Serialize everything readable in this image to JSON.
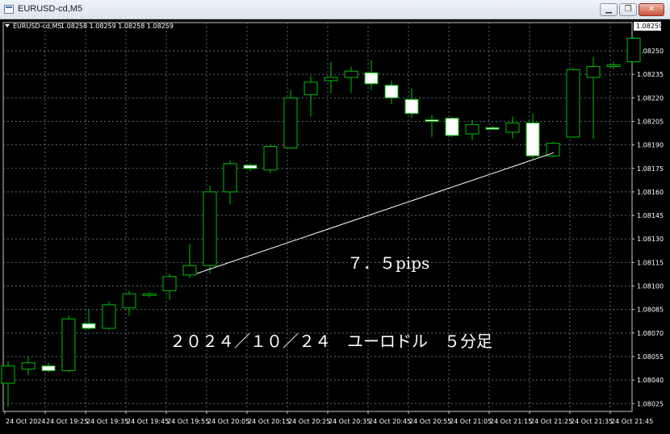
{
  "window": {
    "title": "EURUSD-cd,M5",
    "minimize_icon": "minimize-icon",
    "maximize_icon": "restore-icon",
    "close_icon": "close-icon"
  },
  "chart_info": {
    "symbol": "EURUSD-cd,M5",
    "ohlc": "1.08258 1.08259 1.08258 1.08259"
  },
  "colors": {
    "background": "#000000",
    "grid": "#5a6a7a",
    "bull": "#00c000",
    "bear_fill": "#ffffff",
    "text": "#ffffff"
  },
  "annotations": {
    "pips": "７．５pips",
    "caption": "２０２４／１０／２４　ユーロドル　５分足"
  },
  "chart_data": {
    "type": "candlestick",
    "title": "EURUSD-cd,M5",
    "ylim": [
      1.0802,
      1.08268
    ],
    "y_ticks": [
      "1.08250",
      "1.08235",
      "1.08220",
      "1.08205",
      "1.08190",
      "1.08175",
      "1.08160",
      "1.08145",
      "1.08130",
      "1.08115",
      "1.08100",
      "1.08085",
      "1.08070",
      "1.08055",
      "1.08040",
      "1.08025"
    ],
    "current_price": "1.08259",
    "x_labels": [
      "24 Oct 2024",
      "24 Oct 19:25",
      "24 Oct 19:35",
      "24 Oct 19:45",
      "24 Oct 19:55",
      "24 Oct 20:05",
      "24 Oct 20:15",
      "24 Oct 20:25",
      "24 Oct 20:35",
      "24 Oct 20:45",
      "24 Oct 20:55",
      "24 Oct 21:05",
      "24 Oct 21:15",
      "24 Oct 21:25",
      "24 Oct 21:35",
      "24 Oct 21:45"
    ],
    "candles": [
      {
        "o": 1.08038,
        "h": 1.08052,
        "l": 1.08023,
        "c": 1.08049
      },
      {
        "o": 1.08047,
        "h": 1.08055,
        "l": 1.08043,
        "c": 1.08051
      },
      {
        "o": 1.08049,
        "h": 1.08051,
        "l": 1.08045,
        "c": 1.08046
      },
      {
        "o": 1.08046,
        "h": 1.08081,
        "l": 1.08045,
        "c": 1.08079
      },
      {
        "o": 1.08076,
        "h": 1.08085,
        "l": 1.08072,
        "c": 1.08073
      },
      {
        "o": 1.08073,
        "h": 1.0809,
        "l": 1.08072,
        "c": 1.08088
      },
      {
        "o": 1.08086,
        "h": 1.08097,
        "l": 1.08081,
        "c": 1.08095
      },
      {
        "o": 1.08095,
        "h": 1.08096,
        "l": 1.08093,
        "c": 1.08095
      },
      {
        "o": 1.08097,
        "h": 1.08108,
        "l": 1.08091,
        "c": 1.08106
      },
      {
        "o": 1.08107,
        "h": 1.08127,
        "l": 1.08105,
        "c": 1.08113
      },
      {
        "o": 1.08113,
        "h": 1.08164,
        "l": 1.08108,
        "c": 1.0816
      },
      {
        "o": 1.0816,
        "h": 1.0818,
        "l": 1.08152,
        "c": 1.08178
      },
      {
        "o": 1.08177,
        "h": 1.08178,
        "l": 1.08173,
        "c": 1.08175
      },
      {
        "o": 1.08174,
        "h": 1.0819,
        "l": 1.08172,
        "c": 1.08189
      },
      {
        "o": 1.08188,
        "h": 1.08225,
        "l": 1.08188,
        "c": 1.0822
      },
      {
        "o": 1.08222,
        "h": 1.08234,
        "l": 1.08208,
        "c": 1.0823
      },
      {
        "o": 1.08231,
        "h": 1.08243,
        "l": 1.08223,
        "c": 1.08233
      },
      {
        "o": 1.08233,
        "h": 1.0824,
        "l": 1.08223,
        "c": 1.08237
      },
      {
        "o": 1.08236,
        "h": 1.08244,
        "l": 1.08225,
        "c": 1.08229
      },
      {
        "o": 1.08228,
        "h": 1.08231,
        "l": 1.08216,
        "c": 1.0822
      },
      {
        "o": 1.08219,
        "h": 1.08226,
        "l": 1.08207,
        "c": 1.0821
      },
      {
        "o": 1.08206,
        "h": 1.08209,
        "l": 1.08195,
        "c": 1.08205
      },
      {
        "o": 1.08207,
        "h": 1.08208,
        "l": 1.08195,
        "c": 1.08196
      },
      {
        "o": 1.08197,
        "h": 1.08206,
        "l": 1.08193,
        "c": 1.08203
      },
      {
        "o": 1.08201,
        "h": 1.08202,
        "l": 1.082,
        "c": 1.082
      },
      {
        "o": 1.08198,
        "h": 1.08208,
        "l": 1.08194,
        "c": 1.08204
      },
      {
        "o": 1.08204,
        "h": 1.0821,
        "l": 1.08181,
        "c": 1.08183
      },
      {
        "o": 1.08183,
        "h": 1.08192,
        "l": 1.08182,
        "c": 1.08191
      },
      {
        "o": 1.08195,
        "h": 1.08239,
        "l": 1.08195,
        "c": 1.08238
      },
      {
        "o": 1.08233,
        "h": 1.08246,
        "l": 1.08194,
        "c": 1.0824
      },
      {
        "o": 1.0824,
        "h": 1.08243,
        "l": 1.08238,
        "c": 1.08241
      },
      {
        "o": 1.08243,
        "h": 1.08259,
        "l": 1.08243,
        "c": 1.08258
      }
    ],
    "trendline": {
      "from_candle": 9,
      "from_price": 1.08108,
      "to_candle": 27,
      "to_price": 1.08185
    }
  }
}
